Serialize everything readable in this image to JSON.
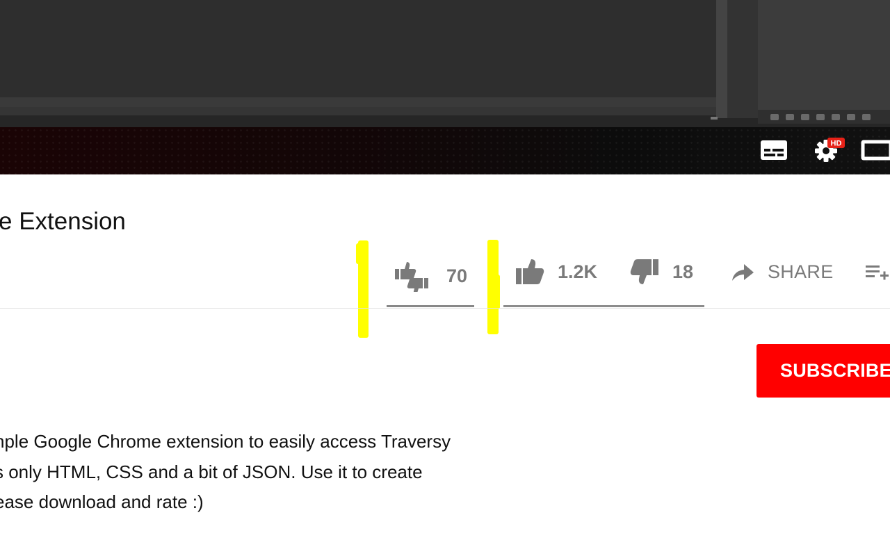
{
  "video": {
    "title": "e Extension"
  },
  "actions": {
    "ratio_count": "70",
    "likes": "1.2K",
    "dislikes": "18",
    "share_label": "SHARE"
  },
  "subscribe": {
    "label": "SUBSCRIBE"
  },
  "description": {
    "lines": [
      "nple Google Chrome extension to easily access Traversy",
      "s only HTML, CSS and a bit of JSON. Use it to create",
      "ease download and rate :)"
    ]
  },
  "colors": {
    "subscribe_red": "#ff0000",
    "highlight_yellow": "#ffff00",
    "icon_gray": "#7a7a7a",
    "hd_badge_red": "#e62117"
  },
  "icons": {
    "ratio": "thumbs-up-down-icon",
    "like": "thumb-up-icon",
    "dislike": "thumb-down-icon",
    "share": "share-arrow-icon",
    "save": "add-to-playlist-icon",
    "subtitles": "subtitles-icon",
    "settings": "settings-gear-icon",
    "theater": "theater-mode-icon"
  }
}
